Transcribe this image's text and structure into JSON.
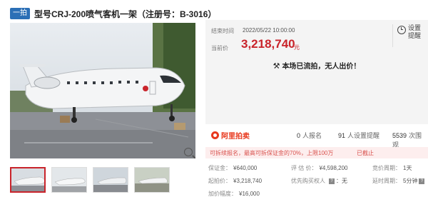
{
  "header": {
    "badge": "一拍",
    "title": "型号CRJ-200喷气客机一架（注册号：B-3016）"
  },
  "gallery": {
    "thumb_count": 4,
    "active_index": 0
  },
  "auction": {
    "end_label": "结束时间",
    "end_time": "2022/05/22 10:00:00",
    "price_label": "当前价",
    "price": "3,218,740",
    "price_unit": "元",
    "reminder_label": "设置提醒",
    "status": "本场已流拍，无人出价！"
  },
  "stats": {
    "brand": "阿里拍卖",
    "signups_value": "0",
    "signups_label": "人报名",
    "reminders_value": "91",
    "reminders_label": "人设置提醒",
    "views_value": "5539",
    "views_label": "次围观"
  },
  "notice": {
    "text": "可拆续报名，最高可拆保证金的70%，上限100万",
    "ended": "已截止"
  },
  "details": {
    "deposit_label": "保证金：",
    "deposit_value": "¥640,000",
    "appraisal_label": "评 估 价：",
    "appraisal_value": "¥4,598,200",
    "period_label": "竞价周期：",
    "period_value": "1天",
    "start_label": "起拍价：",
    "start_value": "¥3,218,740",
    "priority_label": "优先购买权人",
    "priority_value": "：无",
    "delay_label": "延时周期：",
    "delay_value": "5分钟",
    "increment_label": "加价幅度：",
    "increment_value": "¥16,000"
  },
  "colors": {
    "accent": "#c9242b",
    "brand": "#e8381d",
    "badge": "#2b6fb6"
  }
}
